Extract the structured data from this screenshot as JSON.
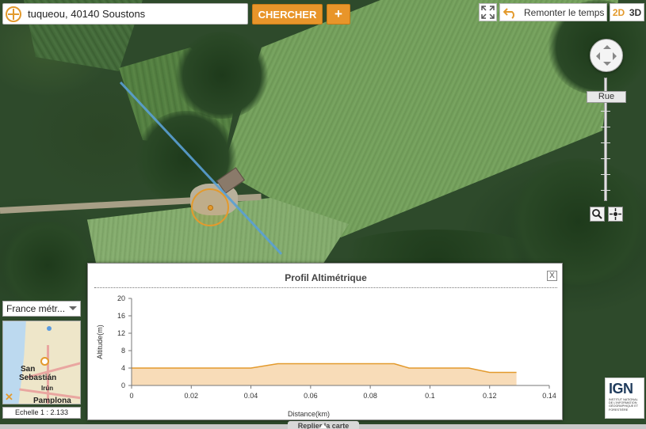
{
  "search": {
    "value": "tuqueou, 40140 Soustons",
    "button_label": "CHERCHER",
    "plus_label": "+"
  },
  "toolbar": {
    "history_label": "Remonter le temps",
    "mode_2d": "2D",
    "mode_3d": "3D"
  },
  "zoom": {
    "level_label": "Rue"
  },
  "minimap": {
    "territory": "France métr...",
    "town_1": "San",
    "town_2": "Sebastián",
    "town_3": "Irún",
    "town_4": "Pamplona",
    "scale": "Echelle 1 : 2.133"
  },
  "logo": {
    "name": "IGN",
    "subtitle": "Institut national de l'information géographique et forestière"
  },
  "profile": {
    "title": "Profil Altimétrique",
    "close_label": "X"
  },
  "bottom": {
    "tab_label": "Replier la carte"
  },
  "colors": {
    "accent": "#e8952a",
    "profile_line": "#5aa0d4",
    "area_fill": "#f8dcb8",
    "area_stroke": "#e39a2d"
  },
  "chart_data": {
    "type": "area",
    "title": "",
    "xlabel": "Distance(km)",
    "ylabel": "Altitude(m)",
    "xlim": [
      0,
      0.14
    ],
    "ylim": [
      0,
      20
    ],
    "xticks": [
      "0",
      "0.02",
      "0.04",
      "0.06",
      "0.08",
      "0.1",
      "0.12",
      "0.14"
    ],
    "yticks": [
      "0",
      "4",
      "8",
      "12",
      "16",
      "20"
    ],
    "x": [
      0,
      0.04,
      0.049,
      0.088,
      0.093,
      0.113,
      0.12,
      0.129
    ],
    "y": [
      4,
      4,
      5,
      5,
      4,
      4,
      3,
      3
    ],
    "grid": false
  }
}
